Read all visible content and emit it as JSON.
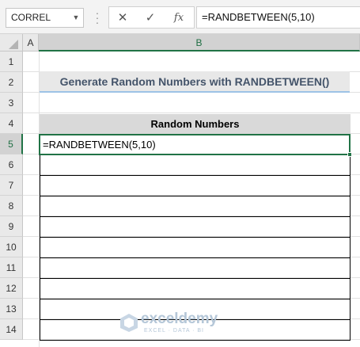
{
  "formula_bar": {
    "name_box": "CORREL",
    "cancel_icon": "close-icon",
    "enter_icon": "check-icon",
    "function_icon": "fx-icon",
    "fx_glyph": "fx",
    "formula": "=RANDBETWEEN(5,10)"
  },
  "columns": [
    "A",
    "B"
  ],
  "selected_column": "B",
  "rows": [
    "1",
    "2",
    "3",
    "4",
    "5",
    "6",
    "7",
    "8",
    "9",
    "10",
    "11",
    "12",
    "13",
    "14"
  ],
  "selected_row": "5",
  "sheet": {
    "title": "Generate Random Numbers with RANDBETWEEN()",
    "table_header": "Random Numbers",
    "active_cell_value": "=RANDBETWEEN(5,10)"
  },
  "watermark": {
    "brand": "exceldemy",
    "tagline": "EXCEL · DATA · BI"
  },
  "colors": {
    "accent_green": "#217346",
    "title_text": "#44546a",
    "title_underline": "#9dc3e6"
  }
}
